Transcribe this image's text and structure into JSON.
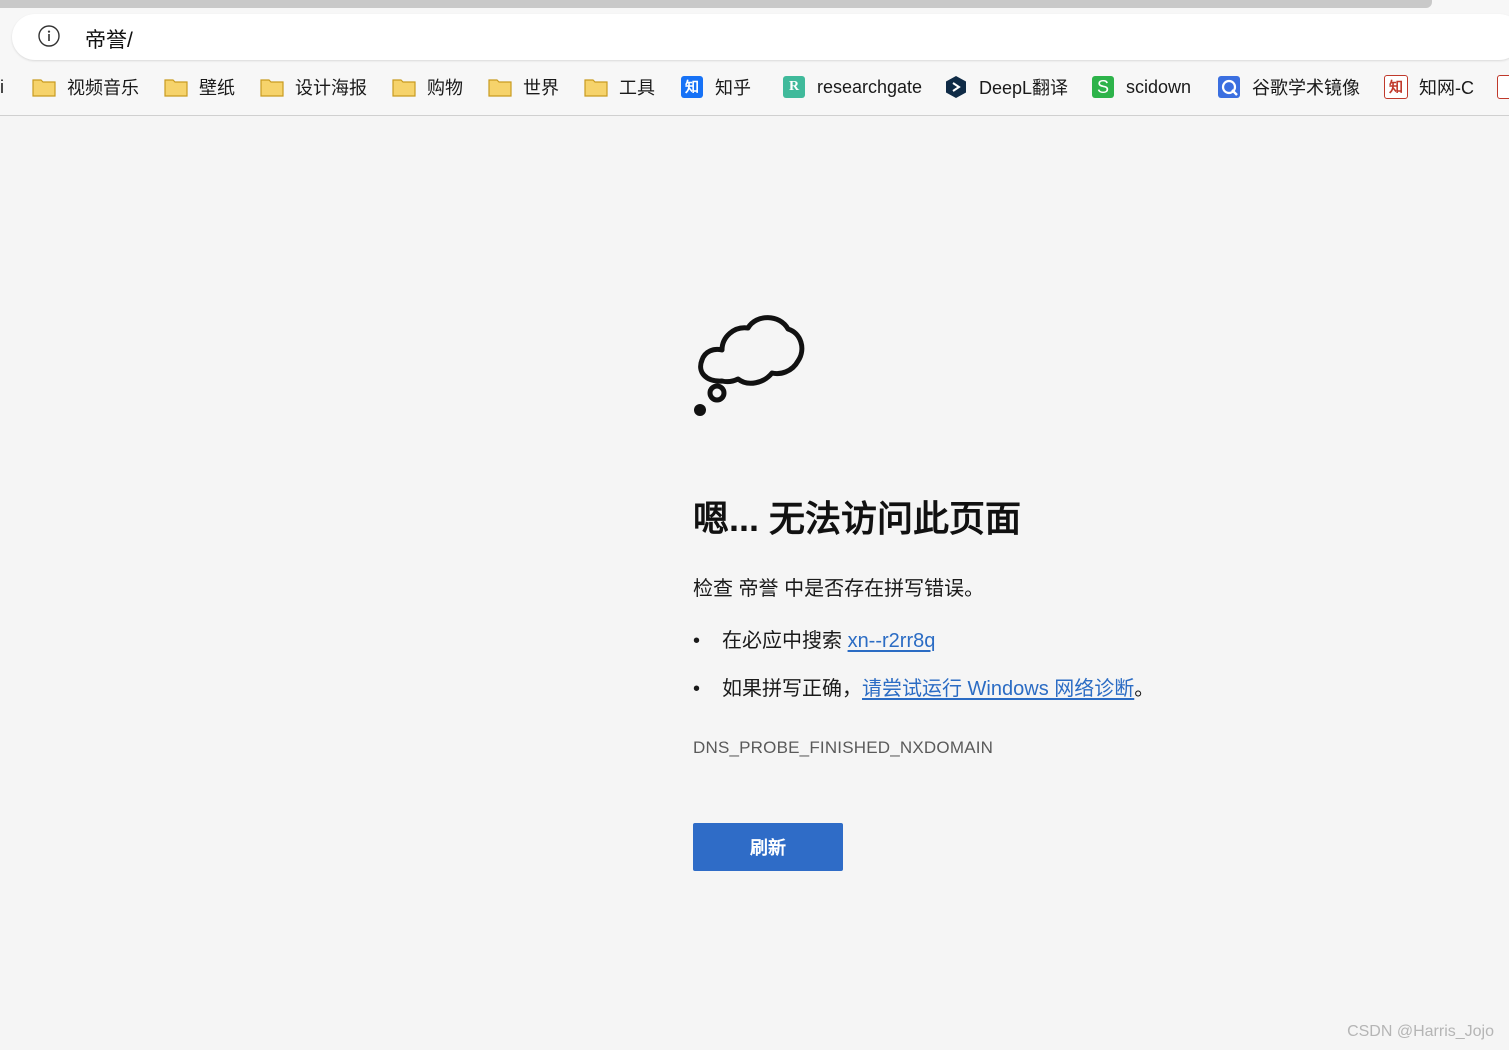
{
  "address_bar": {
    "url": "帝誉/"
  },
  "bookmarks": {
    "left_fragment": "i",
    "items": [
      {
        "label": "视频音乐",
        "icon": "folder-icon"
      },
      {
        "label": "壁纸",
        "icon": "folder-icon"
      },
      {
        "label": "设计海报",
        "icon": "folder-icon"
      },
      {
        "label": "购物",
        "icon": "folder-icon"
      },
      {
        "label": "世界",
        "icon": "folder-icon"
      },
      {
        "label": "工具",
        "icon": "folder-icon"
      },
      {
        "label": "知乎",
        "icon": "zhihu-icon",
        "icon_text": "知",
        "color": "#1772f6"
      },
      {
        "label": "researchgate",
        "icon": "researchgate-icon",
        "icon_text": "R",
        "color": "#40ba9b"
      },
      {
        "label": "DeepL翻译",
        "icon": "deepl-icon",
        "color": "#0f2b46"
      },
      {
        "label": "scidown",
        "icon": "scidown-icon",
        "icon_text": "S",
        "color": "#2db34a"
      },
      {
        "label": "谷歌学术镜像",
        "icon": "scholar-mirror-icon",
        "color": "#3b6fe0"
      },
      {
        "label": "知网-C",
        "icon": "cnki-icon",
        "icon_text": "知",
        "color": "#c0392b"
      }
    ]
  },
  "error": {
    "title": "嗯... 无法访问此页面",
    "description": "检查 帝誉 中是否存在拼写错误。",
    "suggestions": [
      {
        "text": "在必应中搜索 ",
        "link": "xn--r2rr8q",
        "suffix": ""
      },
      {
        "text": "如果拼写正确，",
        "link": "请尝试运行 Windows 网络诊断",
        "suffix": "。"
      }
    ],
    "code": "DNS_PROBE_FINISHED_NXDOMAIN",
    "refresh_label": "刷新"
  },
  "watermark": "CSDN @Harris_Jojo",
  "colors": {
    "accent": "#2f6cc7",
    "link": "#2b6cc4",
    "background": "#f5f5f5",
    "folder": "#f3c94b"
  }
}
